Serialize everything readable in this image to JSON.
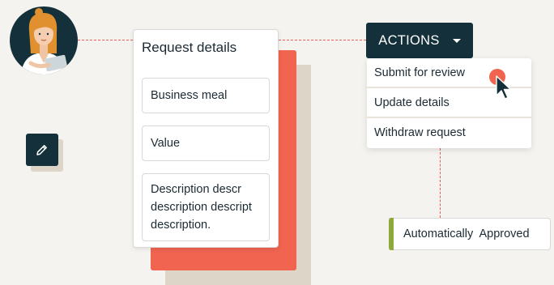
{
  "card": {
    "title": "Request details",
    "fields": [
      {
        "value": "Business meal"
      },
      {
        "value": "Value"
      },
      {
        "value": "Description descr description descript description."
      }
    ]
  },
  "actions": {
    "label": "ACTIONS",
    "menu": [
      {
        "label": "Submit for review"
      },
      {
        "label": "Update details"
      },
      {
        "label": "Withdraw request"
      }
    ]
  },
  "status": {
    "label": "Automatically  Approved",
    "color": "#8fa83b"
  },
  "icons": {
    "avatar": "user-avatar-illustration",
    "edit": "pencil-icon",
    "dropdown": "caret-down-icon",
    "cursor": "mouse-pointer-icon"
  },
  "colors": {
    "background": "#f5f3ef",
    "dark": "#14303a",
    "accent": "#f06450",
    "beige": "#ddd5c8",
    "approved": "#8fa83b"
  }
}
